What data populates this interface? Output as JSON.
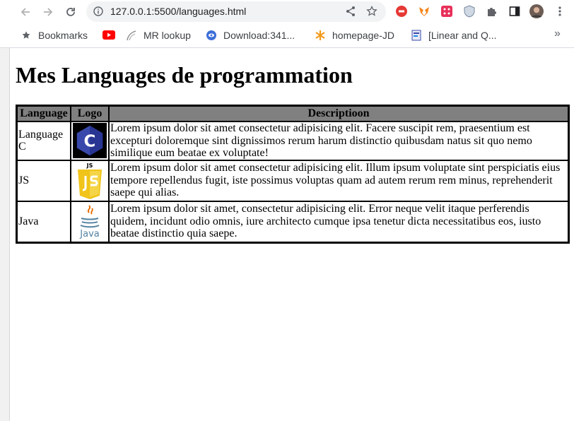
{
  "browser": {
    "url": "127.0.0.1:5500/languages.html",
    "bookmarks": [
      {
        "label": "Bookmarks",
        "icon": "star-icon"
      },
      {
        "label": "",
        "icon": "youtube-icon"
      },
      {
        "label": "MR lookup",
        "icon": "mr-lookup-icon"
      },
      {
        "label": "Download:341...",
        "icon": "download-site-icon"
      },
      {
        "label": "homepage-JD",
        "icon": "asterisk-icon"
      },
      {
        "label": "[Linear and Q...",
        "icon": "book-icon"
      }
    ],
    "more_label": "»"
  },
  "page": {
    "title": "Mes Languages de programmation",
    "headers": [
      "Language",
      "Logo",
      "Descriptioon"
    ],
    "rows": [
      {
        "language": "Language C",
        "logo_text": "C",
        "description": "Lorem ipsum dolor sit amet consectetur adipisicing elit. Facere suscipit rem, praesentium est excepturi doloremque sint dignissimos rerum harum distinctio quibusdam natus sit quo nemo similique eum beatae ex voluptate!"
      },
      {
        "language": "JS",
        "logo_text": "JS",
        "description": "Lorem ipsum dolor sit amet consectetur adipisicing elit. Illum ipsum voluptate sint perspiciatis eius tempore repellendus fugit, iste possimus voluptas quam ad autem rerum rem minus, reprehenderit saepe qui alias."
      },
      {
        "language": "Java",
        "logo_text": "Java",
        "description": "Lorem ipsum dolor sit amet, consectetur adipisicing elit. Error neque velit itaque perferendis quidem, incidunt odio omnis, iure architecto cumque ipsa tenetur dicta necessitatibus eos, iusto beatae distinctio quia saepe."
      }
    ]
  },
  "colors": {
    "header_bg": "#808080",
    "js_yellow": "#f0c419",
    "c_blue": "#3949ab"
  }
}
